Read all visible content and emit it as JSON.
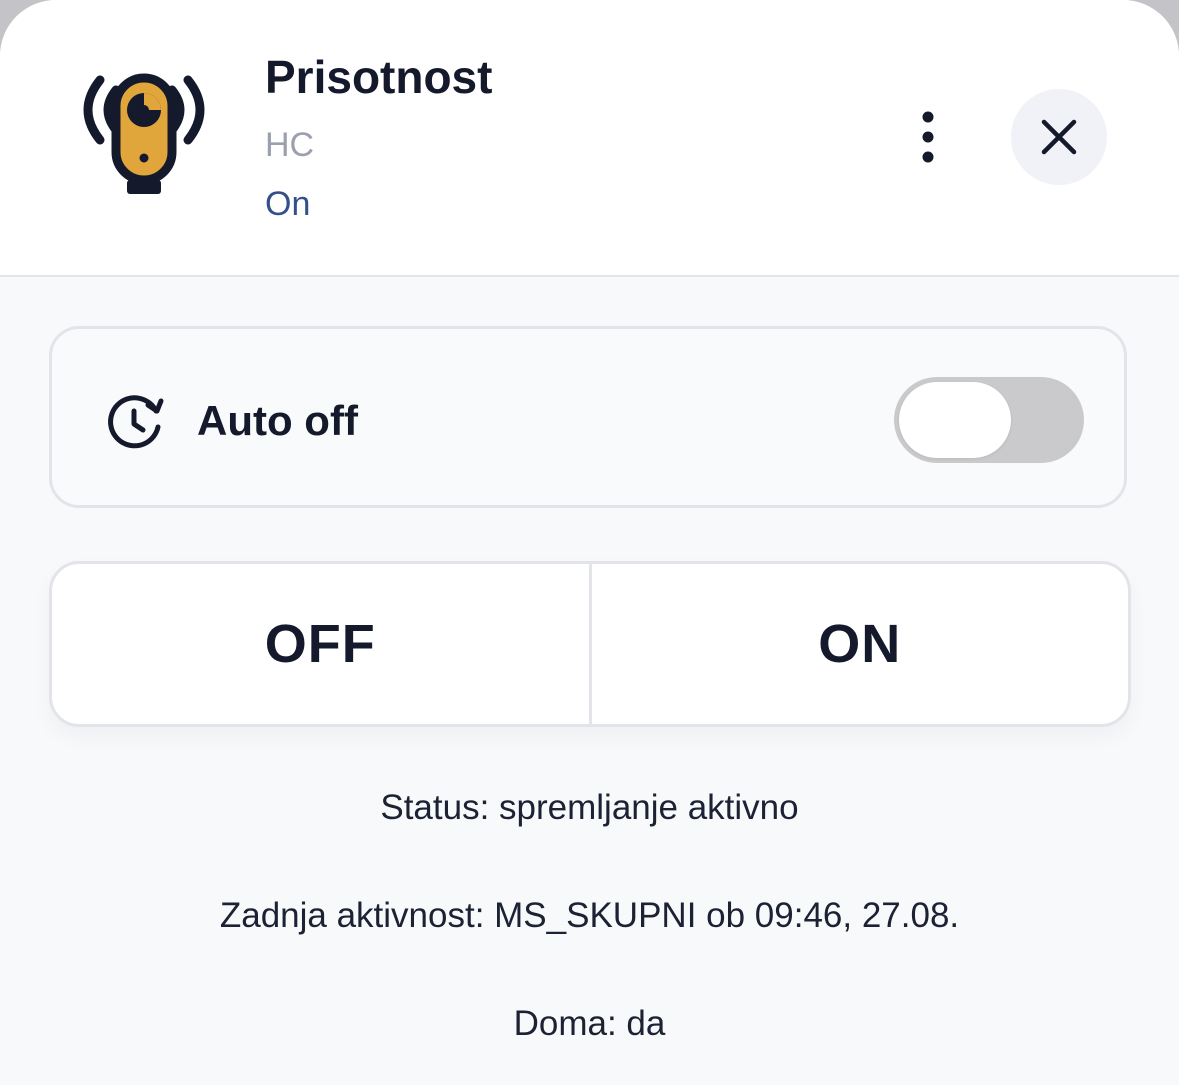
{
  "device": {
    "name": "Prisotnost",
    "room": "HC",
    "state": "On",
    "icon": "presence-sensor-icon",
    "accent_color": "#E0A63B"
  },
  "header": {
    "more_icon": "more-vertical-icon",
    "close_icon": "close-icon"
  },
  "auto_off": {
    "label": "Auto off",
    "icon": "clock-refresh-icon",
    "enabled": false
  },
  "controls": {
    "off_label": "OFF",
    "on_label": "ON"
  },
  "info": {
    "status": "Status: spremljanje aktivno",
    "last_activity": "Zadnja aktivnost: MS_SKUPNI ob 09:46, 27.08.",
    "home": "Doma: da"
  }
}
